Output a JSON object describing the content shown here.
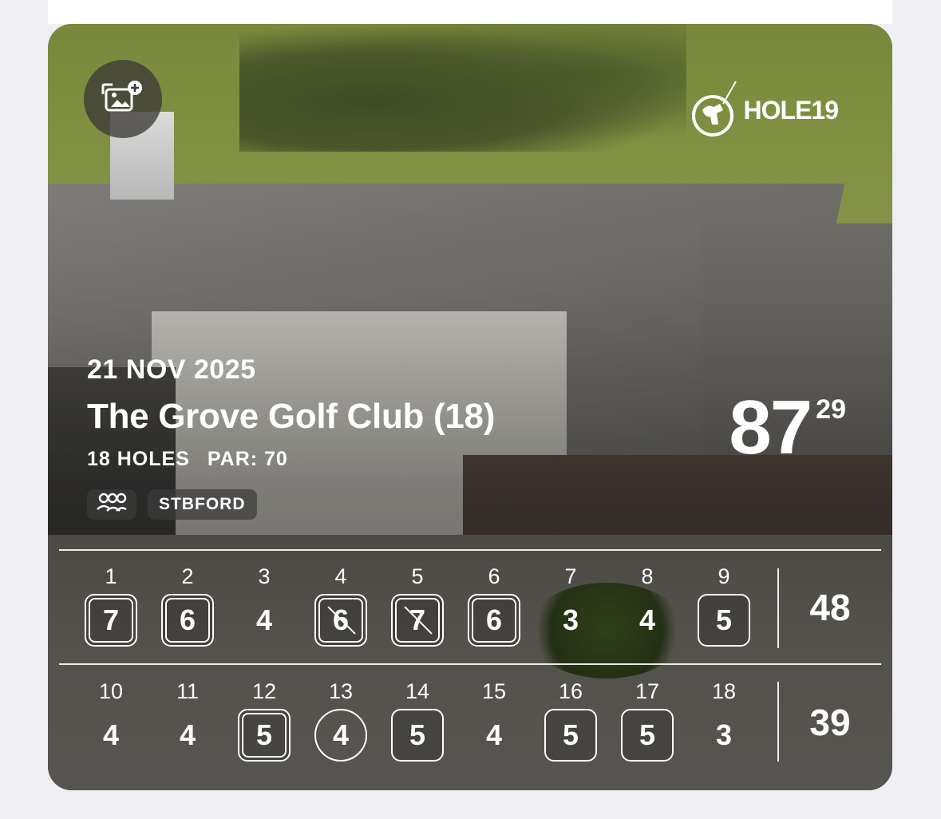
{
  "round": {
    "date": "21 NOV 2025",
    "course": "The Grove Golf Club (18)",
    "holes_label": "18 HOLES",
    "par_label": "PAR: 70",
    "format_tag": "STBFORD",
    "total_score": "87",
    "points": "29"
  },
  "brand": {
    "name": "HOLE19"
  },
  "icons": {
    "add_photo": "add-photo-icon",
    "group": "players-group-icon",
    "brand": "golfer-logo-icon"
  },
  "front_nine": {
    "subtotal": "48",
    "holes": [
      {
        "num": "1",
        "score": "7",
        "mark": "double-square"
      },
      {
        "num": "2",
        "score": "6",
        "mark": "double-square"
      },
      {
        "num": "3",
        "score": "4",
        "mark": "none"
      },
      {
        "num": "4",
        "score": "6",
        "mark": "double-square-struck"
      },
      {
        "num": "5",
        "score": "7",
        "mark": "double-square-struck"
      },
      {
        "num": "6",
        "score": "6",
        "mark": "double-square"
      },
      {
        "num": "7",
        "score": "3",
        "mark": "none"
      },
      {
        "num": "8",
        "score": "4",
        "mark": "none"
      },
      {
        "num": "9",
        "score": "5",
        "mark": "square"
      }
    ]
  },
  "back_nine": {
    "subtotal": "39",
    "holes": [
      {
        "num": "10",
        "score": "4",
        "mark": "none"
      },
      {
        "num": "11",
        "score": "4",
        "mark": "none"
      },
      {
        "num": "12",
        "score": "5",
        "mark": "double-square"
      },
      {
        "num": "13",
        "score": "4",
        "mark": "circle"
      },
      {
        "num": "14",
        "score": "5",
        "mark": "square"
      },
      {
        "num": "15",
        "score": "4",
        "mark": "none"
      },
      {
        "num": "16",
        "score": "5",
        "mark": "square"
      },
      {
        "num": "17",
        "score": "5",
        "mark": "square"
      },
      {
        "num": "18",
        "score": "3",
        "mark": "none"
      }
    ]
  },
  "colors": {
    "text": "#ffffff",
    "page_background": "#efeff4"
  }
}
